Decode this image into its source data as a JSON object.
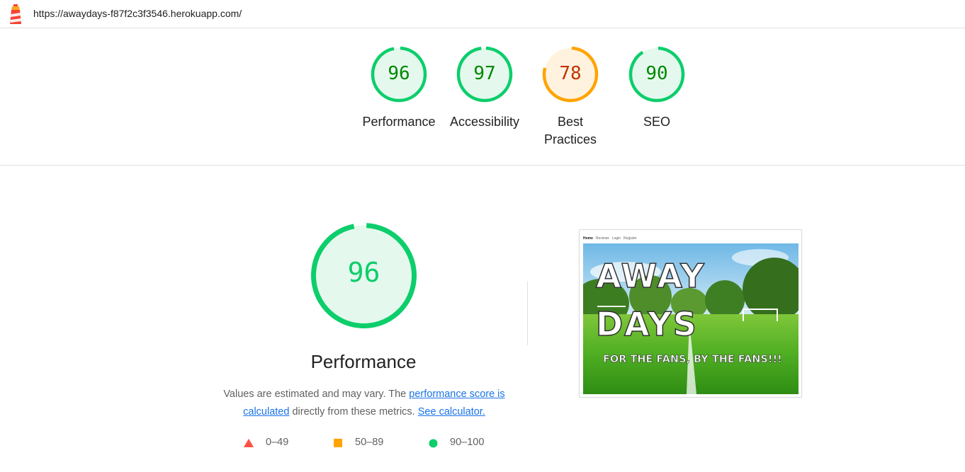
{
  "topbar": {
    "url": "https://awaydays-f87f2c3f3546.herokuapp.com/",
    "logo_icon": "lighthouse-icon"
  },
  "gauges": [
    {
      "score": "96",
      "label": "Performance",
      "value": 96,
      "status": "pass"
    },
    {
      "score": "97",
      "label": "Accessibility",
      "value": 97,
      "status": "pass"
    },
    {
      "score": "78",
      "label": "Best Practices",
      "value": 78,
      "status": "average"
    },
    {
      "score": "90",
      "label": "SEO",
      "value": 90,
      "status": "pass"
    }
  ],
  "colors": {
    "pass": "#0cce6b",
    "pass_text": "#008800",
    "pass_bg": "#e5f8ee",
    "average": "#ffa400",
    "average_text": "#c33300",
    "average_bg": "#fff3e0",
    "fail": "#ff4e42",
    "link": "#1a73e8"
  },
  "performance": {
    "score": "96",
    "value": 96,
    "title": "Performance",
    "desc_prefix": "Values are estimated and may vary. The ",
    "desc_link1": "performance score is calculated",
    "desc_middle": " directly from these metrics. ",
    "desc_link2": "See calculator."
  },
  "legend": [
    {
      "icon": "triangle-icon",
      "label": "0–49"
    },
    {
      "icon": "square-icon",
      "label": "50–89"
    },
    {
      "icon": "circle-icon",
      "label": "90–100"
    }
  ],
  "screenshot": {
    "nav": [
      "Home",
      "Reviews",
      "Login",
      "Register"
    ],
    "hero_line1": "AWAY",
    "hero_line2": "DAYS",
    "tagline": "FOR THE FANS, BY THE FANS!!!"
  }
}
